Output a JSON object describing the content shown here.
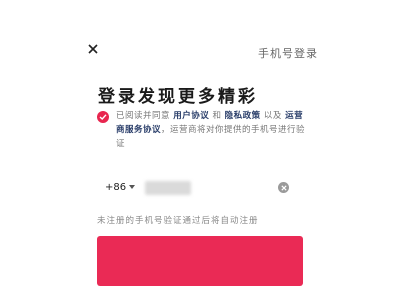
{
  "header": {
    "help_label": "手机号登录",
    "back_icon": "close-icon"
  },
  "page": {
    "title": "登录发现更多精彩"
  },
  "agreement": {
    "prefix": "已阅读并同意",
    "user_agreement": "用户协议",
    "and": "和",
    "privacy_policy": "隐私政策",
    "and2": "以及",
    "operator_agreement": "运营商服务协议",
    "suffix": "，运营商将对你提供的手机号进行验证",
    "checked": true,
    "check_color": "#e8264f"
  },
  "phone": {
    "country_code": "+86",
    "value": "",
    "placeholder": ""
  },
  "hint": "未注册的手机号验证通过后将自动注册",
  "login_button": {
    "label": "",
    "color": "#ea2a55"
  }
}
